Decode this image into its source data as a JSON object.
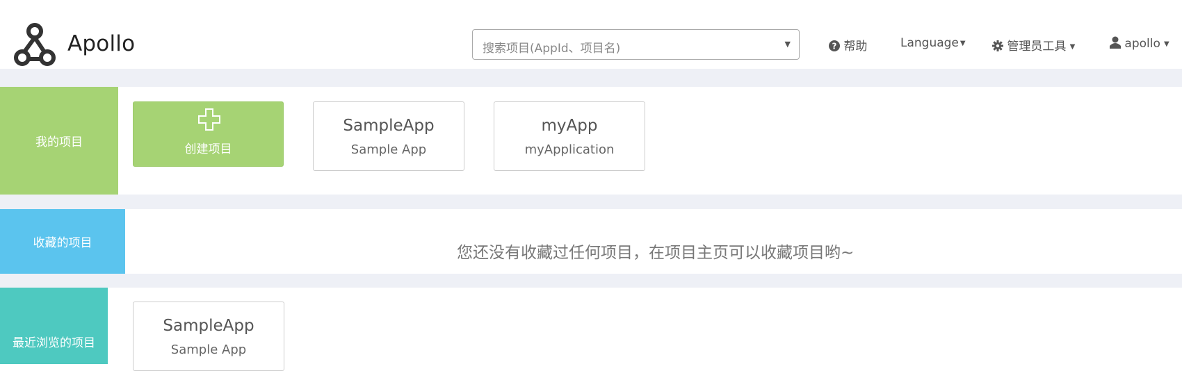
{
  "brand": {
    "name": "Apollo"
  },
  "search": {
    "placeholder": "搜索项目(AppId、项目名)"
  },
  "nav": {
    "help": "帮助",
    "language": "Language",
    "admin_tools": "管理员工具",
    "user": "apollo"
  },
  "sections": {
    "my_projects": {
      "label": "我的项目",
      "color": "#a6d374",
      "create_label": "创建项目",
      "apps": [
        {
          "name": "SampleApp",
          "desc": "Sample App"
        },
        {
          "name": "myApp",
          "desc": "myApplication"
        }
      ]
    },
    "favorites": {
      "label": "收藏的项目",
      "color": "#5bc4ee",
      "empty_message": "您还没有收藏过任何项目，在项目主页可以收藏项目哟~"
    },
    "recent": {
      "label": "最近浏览的项目",
      "color": "#4ec9c0",
      "apps": [
        {
          "name": "SampleApp",
          "desc": "Sample App"
        }
      ]
    }
  },
  "colors": {
    "page_band": "#eef0f6",
    "create_card": "#a6d374"
  }
}
